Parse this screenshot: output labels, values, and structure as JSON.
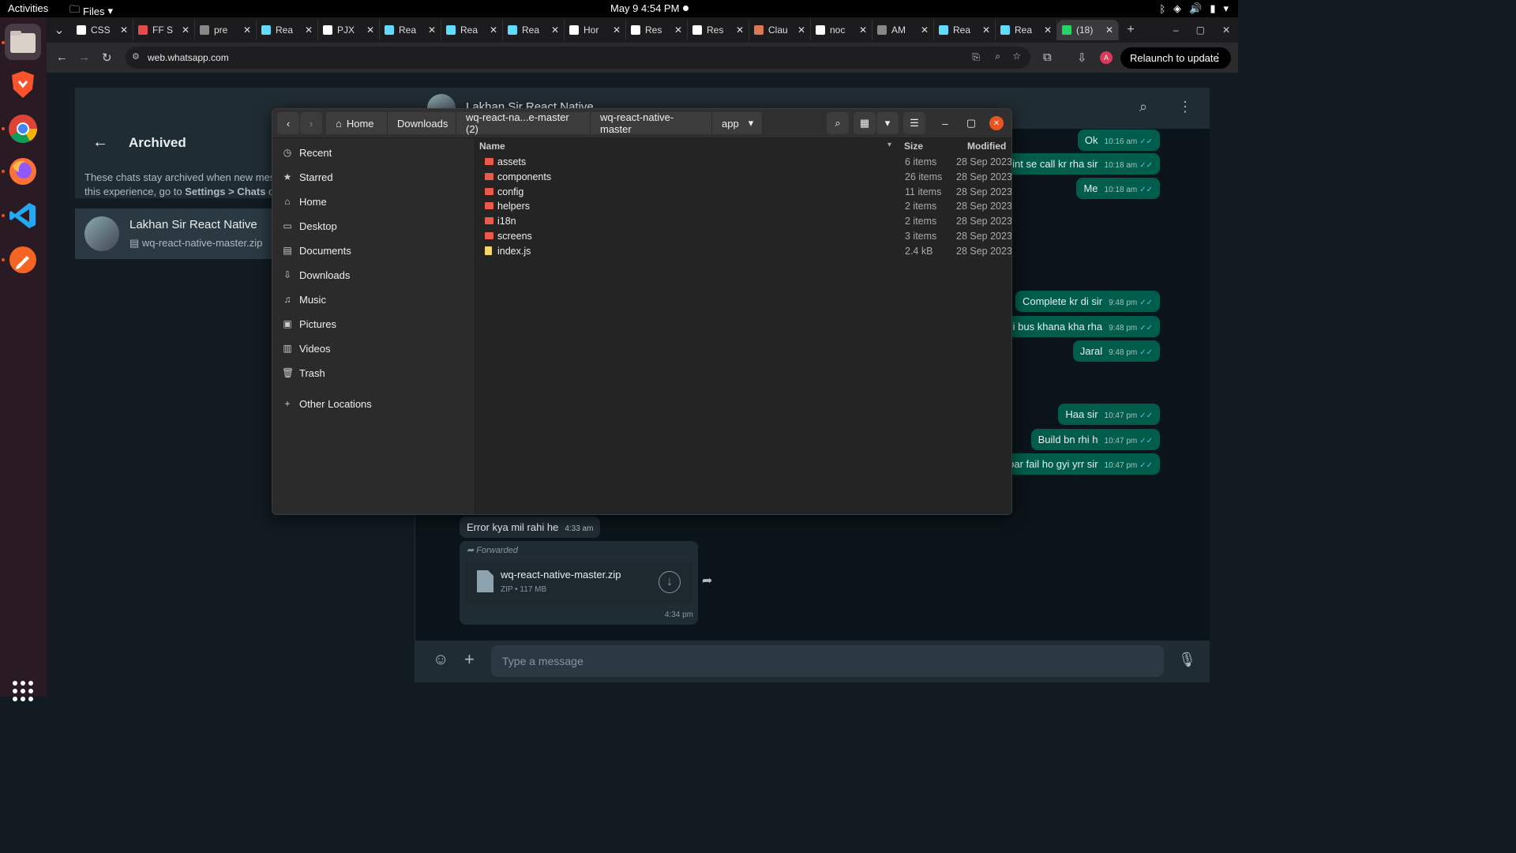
{
  "topbar": {
    "activities": "Activities",
    "app_menu": "Files",
    "clock": "May 9  4:54 PM"
  },
  "dock": {
    "apps": [
      "files-app-icon",
      "brave-icon",
      "chrome-icon",
      "firefox-icon",
      "vscode-icon",
      "color-picker-icon"
    ]
  },
  "tabs": [
    {
      "title": "CSS",
      "color": "#ffffff"
    },
    {
      "title": "FF S",
      "color": "#e34c4c"
    },
    {
      "title": "pre",
      "color": "#888888"
    },
    {
      "title": "Rea",
      "color": "#61dafb"
    },
    {
      "title": "PJX",
      "color": "#ffffff"
    },
    {
      "title": "Rea",
      "color": "#61dafb"
    },
    {
      "title": "Rea",
      "color": "#61dafb"
    },
    {
      "title": "Rea",
      "color": "#61dafb"
    },
    {
      "title": "Hor",
      "color": "#ffffff"
    },
    {
      "title": "Res",
      "color": "#ffffff"
    },
    {
      "title": "Res",
      "color": "#ffffff"
    },
    {
      "title": "Clau",
      "color": "#d97757"
    },
    {
      "title": "noc",
      "color": "#ffffff"
    },
    {
      "title": "AM",
      "color": "#888888"
    },
    {
      "title": "Rea",
      "color": "#61dafb"
    },
    {
      "title": "Rea",
      "color": "#61dafb"
    },
    {
      "title": "(18)",
      "color": "#25d366"
    }
  ],
  "browser": {
    "url": "web.whatsapp.com",
    "relaunch": "Relaunch to update",
    "profile_initial": "A"
  },
  "whatsapp": {
    "archived_title": "Archived",
    "archived_note_1": "These chats stay archived when new mess",
    "archived_note_2_a": "this experience, go to ",
    "archived_note_2_b": "Settings > Chats",
    "archived_note_2_c": " or",
    "chat_name": "Lakhan Sir React Native",
    "chat_preview": "wq-react-native-master.zip",
    "header_name": "Lakhan Sir React Native",
    "messages": [
      {
        "text": "Ok",
        "time": "10:16 am",
        "out": true
      },
      {
        "text": "mint se call kr rha sir",
        "time": "10:18 am",
        "out": true
      },
      {
        "text": "Me",
        "time": "10:18 am",
        "out": true
      },
      {
        "text": "Complete kr di sir",
        "time": "9:48 pm",
        "out": true
      },
      {
        "text": "hi bus khana kha rha",
        "time": "9:48 pm",
        "out": true
      },
      {
        "text": "Jaral",
        "time": "9:48 pm",
        "out": true
      },
      {
        "text": "Haa sir",
        "time": "10:47 pm",
        "out": true
      },
      {
        "text": "Build bn rhi h",
        "time": "10:47 pm",
        "out": true
      },
      {
        "text": "bar fail ho gyi yrr sir",
        "time": "10:47 pm",
        "out": true
      },
      {
        "text": "Error kya mil rahi he",
        "time": "4:33 am",
        "out": false
      }
    ],
    "forwarded_label": "Forwarded",
    "file_name": "wq-react-native-master.zip",
    "file_meta": "ZIP • 117 MB",
    "file_time": "4:34 pm",
    "composer_placeholder": "Type a message"
  },
  "file_manager": {
    "breadcrumbs": [
      "Home",
      "Downloads",
      "wq-react-na...e-master (2)",
      "wq-react-native-master",
      "app"
    ],
    "sidebar": [
      "Recent",
      "Starred",
      "Home",
      "Desktop",
      "Documents",
      "Downloads",
      "Music",
      "Pictures",
      "Videos",
      "Trash",
      "Other Locations"
    ],
    "columns": {
      "name": "Name",
      "size": "Size",
      "modified": "Modified"
    },
    "rows": [
      {
        "name": "assets",
        "size": "6 items",
        "modified": "28 Sep 2023",
        "type": "folder"
      },
      {
        "name": "components",
        "size": "26 items",
        "modified": "28 Sep 2023",
        "type": "folder"
      },
      {
        "name": "config",
        "size": "11 items",
        "modified": "28 Sep 2023",
        "type": "folder"
      },
      {
        "name": "helpers",
        "size": "2 items",
        "modified": "28 Sep 2023",
        "type": "folder"
      },
      {
        "name": "i18n",
        "size": "2 items",
        "modified": "28 Sep 2023",
        "type": "folder"
      },
      {
        "name": "screens",
        "size": "3 items",
        "modified": "28 Sep 2023",
        "type": "folder"
      },
      {
        "name": "index.js",
        "size": "2.4 kB",
        "modified": "28 Sep 2023",
        "type": "file"
      }
    ]
  }
}
